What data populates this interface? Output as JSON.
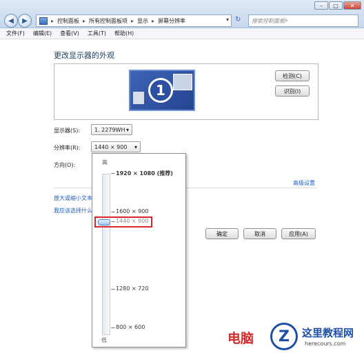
{
  "breadcrumb": [
    "控制面板",
    "所有控制面板项",
    "显示",
    "屏幕分辨率"
  ],
  "search": {
    "placeholder": "搜索控制面板"
  },
  "menu": [
    "文件(F)",
    "编辑(E)",
    "查看(V)",
    "工具(T)",
    "帮助(H)"
  ],
  "main": {
    "heading": "更改显示器的外观",
    "monitor_number": "1",
    "detect_button": "检测(C)",
    "identify_button": "识别(I)",
    "display_label": "显示器(S):",
    "display_value": "1. 2279WH",
    "resolution_label": "分辨率(R):",
    "resolution_value": "1440 × 900",
    "orientation_label": "方向(O):",
    "advanced_link": "高级设置",
    "text_size_link": "放大或缩小文本",
    "which_link": "我应该选择什么"
  },
  "dropdown": {
    "high_label": "高",
    "low_label": "低",
    "options": [
      "1920 × 1080 (推荐)",
      "1600 × 900",
      "1440 × 900",
      "1280 × 720",
      "800 × 600"
    ],
    "selected": "1440 × 900"
  },
  "buttons": {
    "ok": "确定",
    "cancel": "取消",
    "apply": "应用(A)"
  },
  "watermark": {
    "text_left": "电脑",
    "text_right": "这里教程网",
    "url": "herecours.com"
  },
  "colors": {
    "accent": "#1a5ec4",
    "highlight_box": "#d9262c",
    "monitor_blue": "#2d4fa1"
  }
}
